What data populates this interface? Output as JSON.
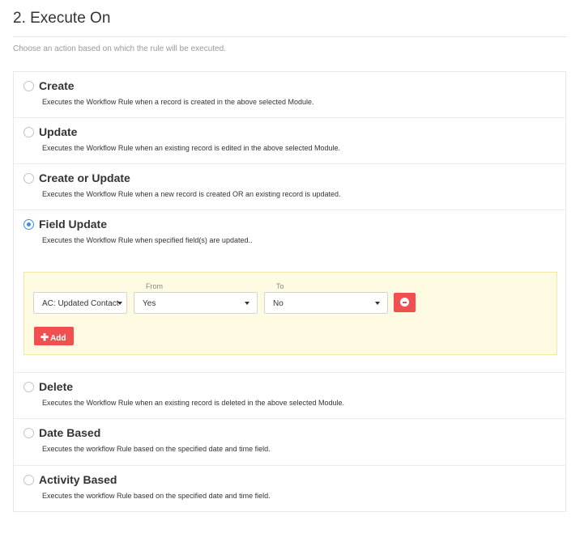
{
  "section": {
    "title": "2. Execute On",
    "subtitle": "Choose an action based on which the rule will be executed."
  },
  "options": [
    {
      "label": "Create",
      "desc": "Executes the Workflow Rule when a record is created in the above selected Module.",
      "selected": false
    },
    {
      "label": "Update",
      "desc": "Executes the Workflow Rule when an existing record is edited in the above selected Module.",
      "selected": false
    },
    {
      "label": "Create or Update",
      "desc": "Executes the Workflow Rule when a new record is created OR an existing record is updated.",
      "selected": false
    },
    {
      "label": "Field Update",
      "desc": "Executes the Workflow Rule when specified field(s) are updated..",
      "selected": true
    },
    {
      "label": "Delete",
      "desc": "Executes the Workflow Rule when an existing record is deleted in the above selected Module.",
      "selected": false
    },
    {
      "label": "Date Based",
      "desc": "Executes the workflow Rule based on the specified date and time field.",
      "selected": false
    },
    {
      "label": "Activity Based",
      "desc": "Executes the workflow Rule based on the specified date and time field.",
      "selected": false
    }
  ],
  "field_update": {
    "field_value": "AC: Updated Contact",
    "from_label": "From",
    "from_value": "Yes",
    "to_label": "To",
    "to_value": "No",
    "add_label": "Add"
  },
  "colors": {
    "accent": "#3a8ee6",
    "danger": "#f05050",
    "panel_bg": "#fffbe3"
  }
}
